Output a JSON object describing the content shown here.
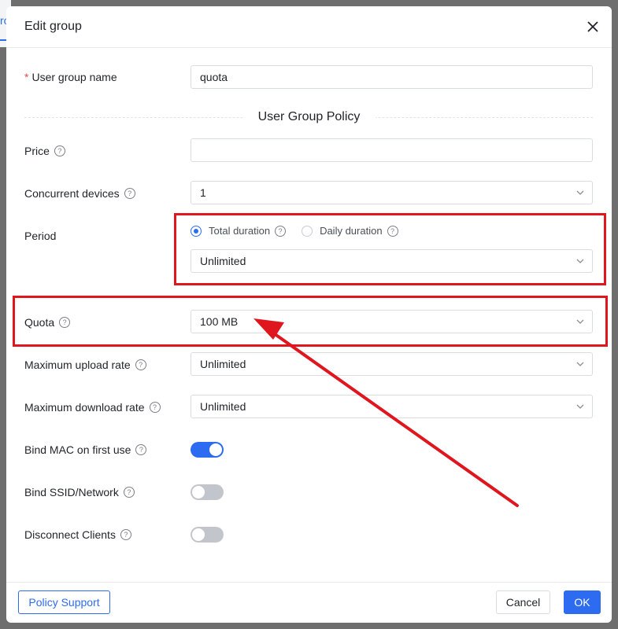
{
  "dialog": {
    "title": "Edit group",
    "fields": {
      "group_name": {
        "label": "User group name",
        "value": "quota"
      },
      "section_title": "User Group Policy",
      "price": {
        "label": "Price",
        "value": ""
      },
      "concurrent": {
        "label": "Concurrent devices",
        "value": "1"
      },
      "period": {
        "label": "Period",
        "option_total": "Total duration",
        "option_daily": "Daily duration",
        "selected": "total",
        "value": "Unlimited"
      },
      "quota": {
        "label": "Quota",
        "value": "100 MB"
      },
      "upload": {
        "label": "Maximum upload rate",
        "value": "Unlimited"
      },
      "download": {
        "label": "Maximum download rate",
        "value": "Unlimited"
      },
      "bind_mac": {
        "label": "Bind MAC on first use",
        "on": true
      },
      "bind_ssid": {
        "label": "Bind SSID/Network",
        "on": false
      },
      "disconnect": {
        "label": "Disconnect Clients",
        "on": false
      }
    },
    "footer": {
      "policy_support": "Policy Support",
      "cancel": "Cancel",
      "ok": "OK"
    }
  },
  "backdrop": {
    "tab_fragment": "ro"
  },
  "colors": {
    "accent": "#2d6cf0",
    "annotation": "#e0161f"
  },
  "icons": [
    "close-icon",
    "help-icon",
    "chevron-down-icon"
  ]
}
